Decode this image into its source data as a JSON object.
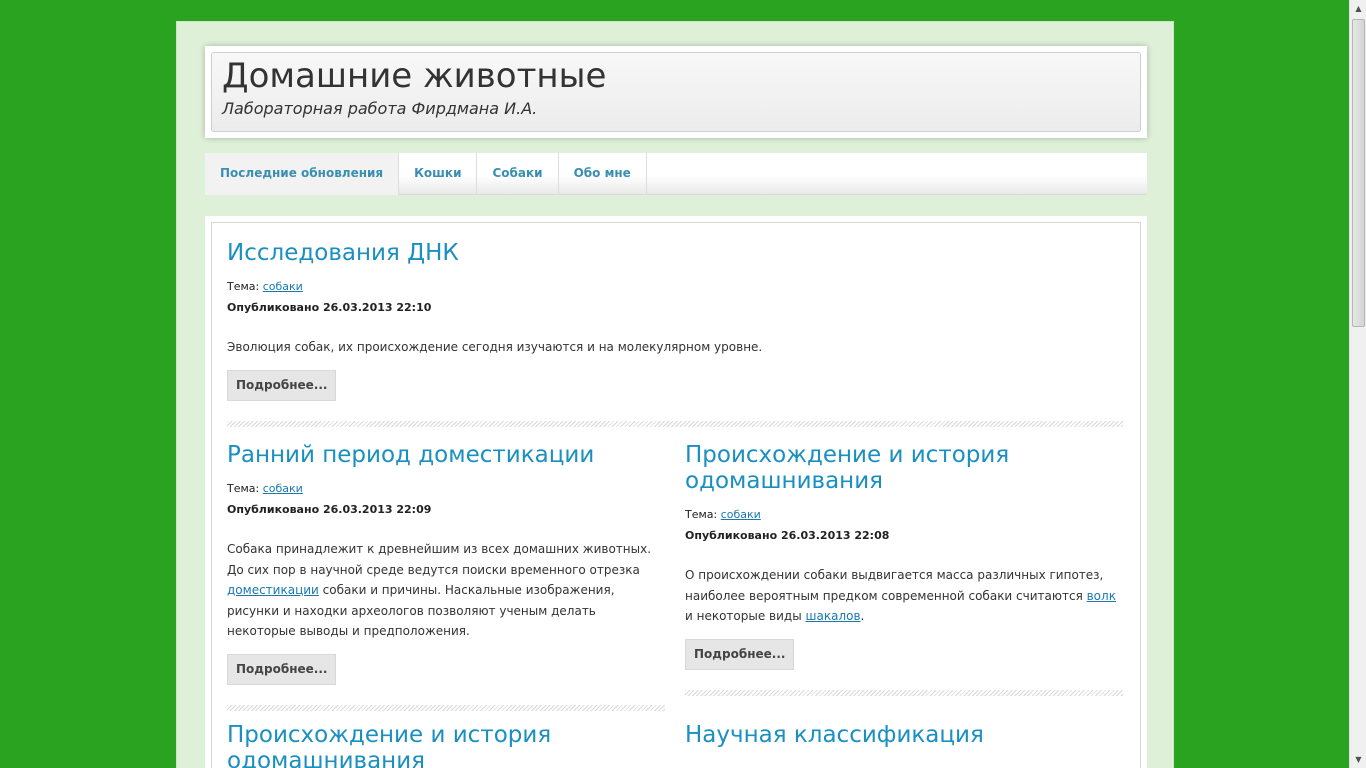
{
  "site": {
    "title": "Домашние животные",
    "description": "Лабораторная работа Фирдмана И.А."
  },
  "nav": {
    "items": [
      {
        "label": "Последние обновления",
        "active": true
      },
      {
        "label": "Кошки"
      },
      {
        "label": "Собаки"
      },
      {
        "label": "Обо мне"
      }
    ]
  },
  "posts": [
    {
      "title": "Исследования ДНК",
      "topic_label": "Тема:",
      "topic": "собаки",
      "published": "Опубликовано 26.03.2013 22:10",
      "excerpt": "Эволюция собак, их происхождение сегодня изучаются и на молекулярном уровне.",
      "more": "Подробнее..."
    },
    {
      "title": "Ранний период доместикации",
      "topic_label": "Тема:",
      "topic": "собаки",
      "published": "Опубликовано 26.03.2013 22:09",
      "excerpt_parts": [
        "Собака принадлежит к древнейшим из всех домашних животных. До сих пор в научной среде ведутся поиски временного отрезка ",
        "доместикации",
        " собаки и причины. Наскальные изображения, рисунки и находки археологов позволяют ученым делать некоторые выводы и предположения."
      ],
      "more": "Подробнее..."
    },
    {
      "title": "Происхождение и история одомашнивания",
      "topic_label": "Тема:",
      "topic": "собаки",
      "published": "Опубликовано 26.03.2013 22:08",
      "excerpt_parts": [
        "О происхождении собаки выдвигается масса различных гипотез, наиболее вероятным предком современной собаки считаются ",
        "волк",
        " и некоторые виды ",
        "шакалов",
        "."
      ],
      "more": "Подробнее..."
    },
    {
      "title": "Происхождение и история одомашнивания"
    },
    {
      "title": "Научная классификация"
    }
  ],
  "colors": {
    "background": "#2aa321",
    "link": "#1a8fc0",
    "nav_text": "#3a8fb0"
  }
}
